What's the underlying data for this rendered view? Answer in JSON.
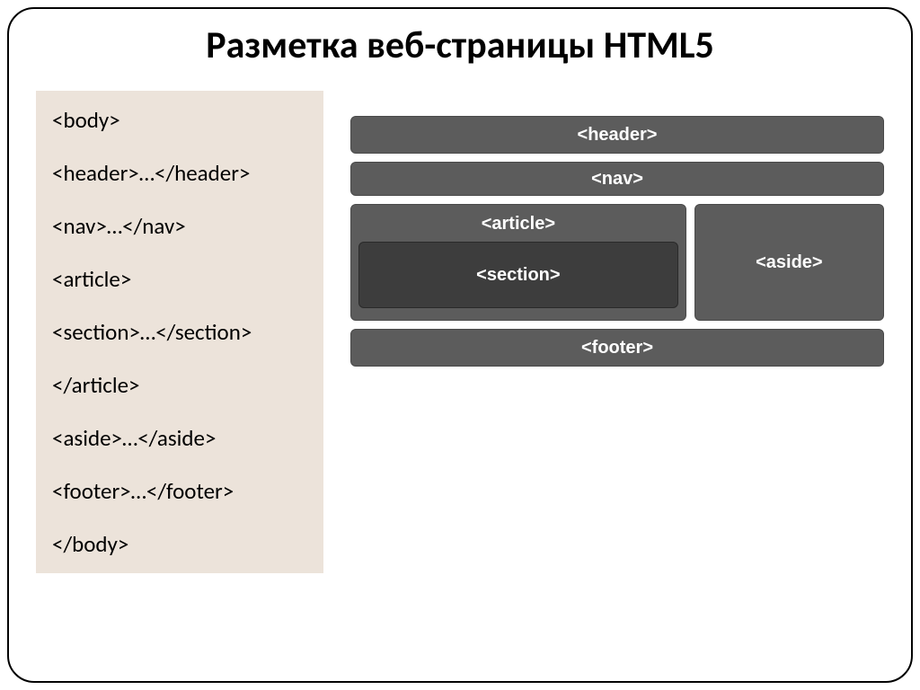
{
  "title": "Разметка веб-страницы HTML5",
  "code": {
    "line1": "<body>",
    "line2": "<header>…</header>",
    "line3": "<nav>…</nav>",
    "line4": "<article>",
    "line5": "<section>…</section>",
    "line6": "</article>",
    "line7": "<aside>…</aside>",
    "line8": "<footer>…</footer>",
    "line9": "</body>"
  },
  "diagram": {
    "header": "<header>",
    "nav": "<nav>",
    "article": "<article>",
    "section": "<section>",
    "aside": "<aside>",
    "footer": "<footer>"
  }
}
